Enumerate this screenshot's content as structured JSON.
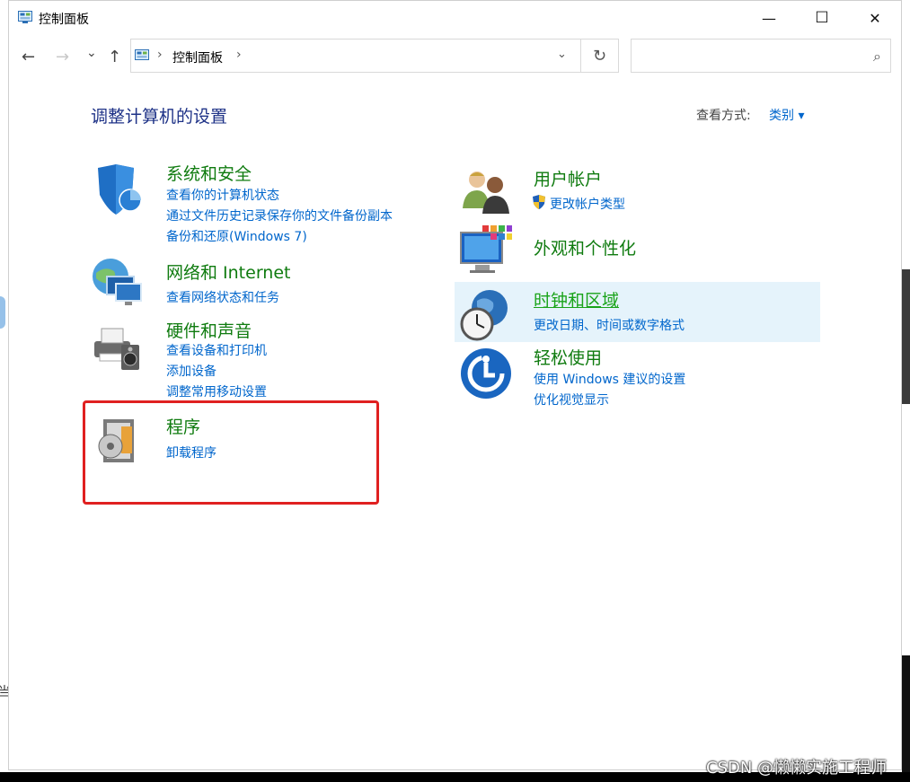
{
  "window": {
    "title": "控制面板"
  },
  "titlebar": {
    "min": "—",
    "max": "☐",
    "close": "✕"
  },
  "nav": {
    "back": "←",
    "forward": "→",
    "recent": "⌄",
    "up": "↑"
  },
  "address": {
    "sep1": "›",
    "location": "控制面板",
    "sep2": "›",
    "dropdown": "⌄",
    "refresh": "↻"
  },
  "search": {
    "placeholder": "",
    "icon": "⌕"
  },
  "heading": "调整计算机的设置",
  "view_by": {
    "label": "查看方式:",
    "value": "类别 ▾"
  },
  "categories": {
    "system": {
      "title": "系统和安全",
      "links": [
        "查看你的计算机状态",
        "通过文件历史记录保存你的文件备份副本",
        "备份和还原(Windows 7)"
      ]
    },
    "network": {
      "title": "网络和 Internet",
      "links": [
        "查看网络状态和任务"
      ]
    },
    "hardware": {
      "title": "硬件和声音",
      "links": [
        "查看设备和打印机",
        "添加设备",
        "调整常用移动设置"
      ]
    },
    "programs": {
      "title": "程序",
      "links": [
        "卸载程序"
      ]
    },
    "users": {
      "title": "用户帐户",
      "links": [
        "更改帐户类型"
      ]
    },
    "appearance": {
      "title": "外观和个性化",
      "links": []
    },
    "clock": {
      "title": "时钟和区域",
      "links": [
        "更改日期、时间或数字格式"
      ]
    },
    "ease": {
      "title": "轻松使用",
      "links": [
        "使用 Windows 建议的设置",
        "优化视觉显示"
      ]
    }
  },
  "background": {
    "left_fragment": "当"
  },
  "watermark": "CSDN @懒懒实施工程师",
  "colors": {
    "title_green": "#0f7b0f",
    "link_blue": "#0066cc",
    "heading_blue": "#1e3287",
    "highlight": "#e5f3fb",
    "annotation_red": "#e02020"
  }
}
